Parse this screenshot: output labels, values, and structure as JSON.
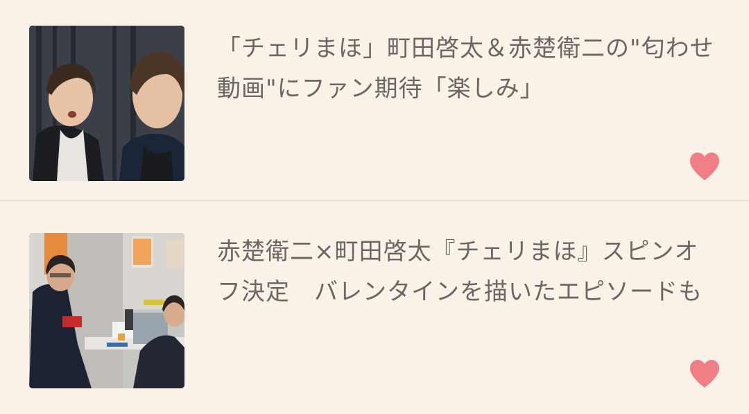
{
  "articles": [
    {
      "title": "「チェリまほ」町田啓太＆赤楚衛二の\"匂わせ動画\"にファン期待「楽しみ」",
      "thumbnail": "two-men-selfie-photo",
      "favorite_icon": "heart-icon",
      "favorite_color": "#f07e86"
    },
    {
      "title": "赤楚衛二×町田啓太『チェリまほ』スピンオフ決定　バレンタインを描いたエピソードも",
      "thumbnail": "office-scene-photo",
      "favorite_icon": "heart-icon",
      "favorite_color": "#f07e86"
    }
  ]
}
